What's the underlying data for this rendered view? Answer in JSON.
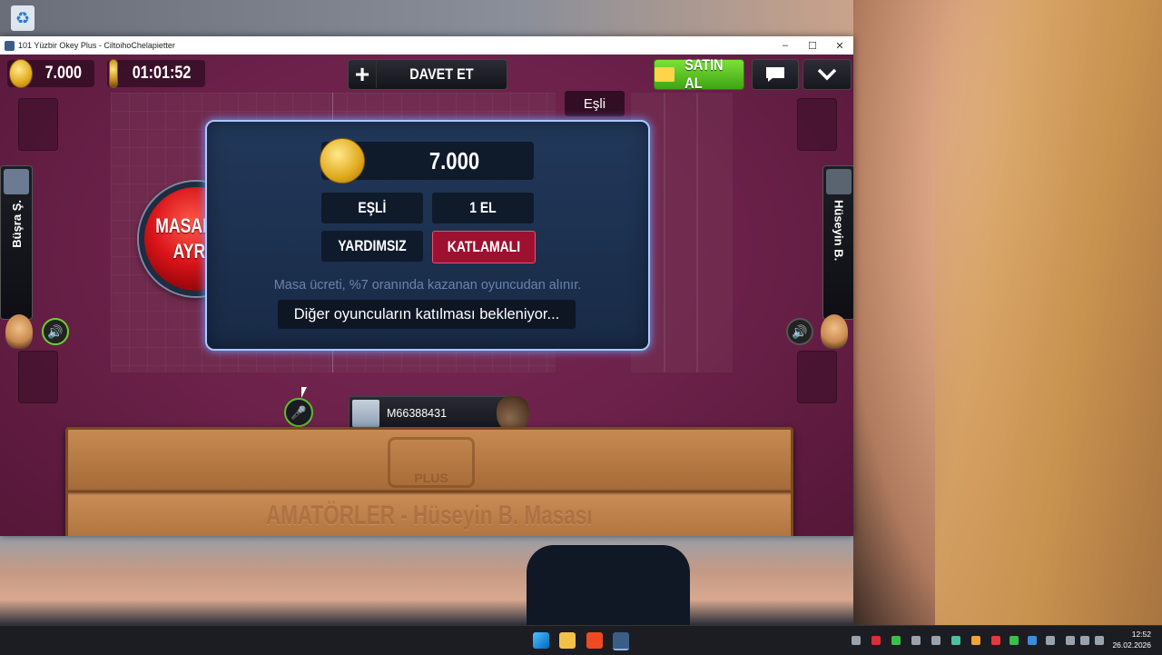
{
  "window": {
    "title": "101 Yüzbir Okey Plus - CiltoihoChelapietter",
    "minimize": "–",
    "maximize": "☐",
    "close": "✕"
  },
  "topbar": {
    "coins": "7.000",
    "timer": "01:01:52",
    "invite_label": "DAVET ET",
    "invite_icon": "plus-icon",
    "buy_label": "SATIN AL",
    "buy_icon": "ticket-icon",
    "chat_icon": "chat-bubble-icon",
    "menu_icon": "chevron-down-icon"
  },
  "table": {
    "partner_tag": "Eşli",
    "left_player": "Büşra Ş.",
    "right_player": "Hüseyin B.",
    "my_player": "M66388431",
    "speaker_glyph": "🔊",
    "mic_glyph": "🎤"
  },
  "leave_button": {
    "line1": "MASADAN",
    "line2": "AYRIL"
  },
  "dialog": {
    "stake": "7.000",
    "mode": "EŞLİ",
    "rounds": "1 EL",
    "helper": "YARDIMSIZ",
    "doubling": "KATLAMALI",
    "fee_note": "Masa ücreti, %7 oranında kazanan oyuncudan alınır.",
    "waiting": "Diğer oyuncuların katılması bekleniyor..."
  },
  "rack": {
    "logo_text": "PLUS",
    "caption": "AMATÖRLER - Hüseyin B. Masası"
  },
  "taskbar": {
    "time": "12:52",
    "date": "26.02.2026"
  },
  "colors": {
    "table_bg": "#6b2149",
    "dialog_border": "#a8c8ff",
    "buy_green": "#3ea412",
    "leave_red": "#d9141a",
    "katlamali_red": "#9e1030"
  }
}
